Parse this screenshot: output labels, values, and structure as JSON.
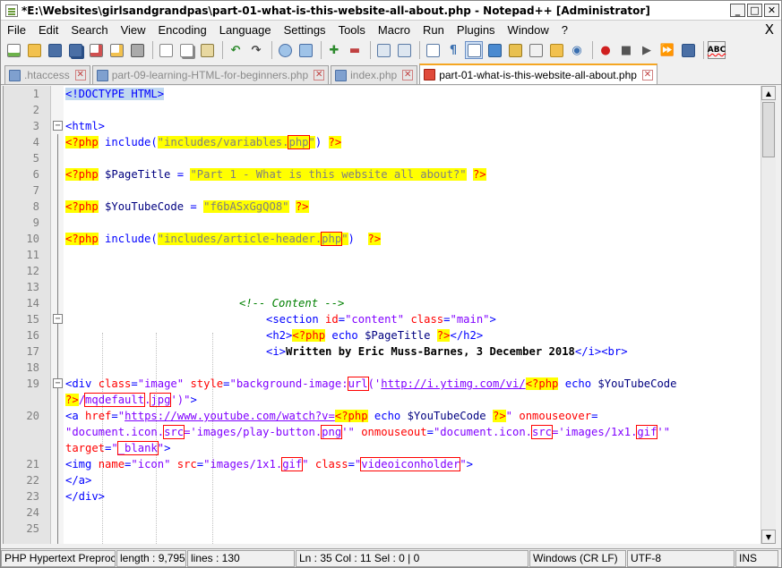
{
  "window": {
    "title": "*E:\\Websites\\girlsandgrandpas\\part-01-what-is-this-website-all-about.php - Notepad++ [Administrator]",
    "min": "_",
    "max": "□",
    "close": "✕"
  },
  "menu": [
    "File",
    "Edit",
    "Search",
    "View",
    "Encoding",
    "Language",
    "Settings",
    "Tools",
    "Macro",
    "Run",
    "Plugins",
    "Window",
    "?"
  ],
  "menu_close": "X",
  "tabs": [
    {
      "label": ".htaccess",
      "active": false
    },
    {
      "label": "part-09-learning-HTML-for-beginners.php",
      "active": false
    },
    {
      "label": "index.php",
      "active": false
    },
    {
      "label": "part-01-what-is-this-website-all-about.php",
      "active": true
    }
  ],
  "tab_close": "✕",
  "lines": [
    {
      "n": "1"
    },
    {
      "n": "2"
    },
    {
      "n": "3"
    },
    {
      "n": "4"
    },
    {
      "n": "5"
    },
    {
      "n": "6"
    },
    {
      "n": "7"
    },
    {
      "n": "8"
    },
    {
      "n": "9"
    },
    {
      "n": "10"
    },
    {
      "n": "11"
    },
    {
      "n": "12"
    },
    {
      "n": "13"
    },
    {
      "n": "14"
    },
    {
      "n": "15"
    },
    {
      "n": "16"
    },
    {
      "n": "17"
    },
    {
      "n": "18"
    },
    {
      "n": "19"
    },
    {
      "n": "20"
    },
    {
      "n": "21"
    },
    {
      "n": "22"
    },
    {
      "n": "23"
    },
    {
      "n": "24"
    },
    {
      "n": "25"
    }
  ],
  "code": {
    "l1": "<!DOCTYPE HTML>",
    "l3": "<html>",
    "l4_a": "<?php",
    "l4_b": " include(",
    "l4_c": "\"includes/variables.",
    "l4_d": "php",
    "l4_e": "\"",
    "l4_f": ") ",
    "l4_g": "?>",
    "l6_a": "<?php",
    "l6_b": " $PageTitle ",
    "l6_c": "= ",
    "l6_d": "\"Part 1 - What is this website all about?\"",
    "l6_e": " ",
    "l6_f": "?>",
    "l8_a": "<?php",
    "l8_b": " $YouTubeCode ",
    "l8_c": "= ",
    "l8_d": "\"f6bASxGgQO8\"",
    "l8_e": " ",
    "l8_f": "?>",
    "l10_a": "<?php",
    "l10_b": " include(",
    "l10_c": "\"includes/article-header.",
    "l10_d": "php",
    "l10_e": "\"",
    "l10_f": ")  ",
    "l10_g": "?>",
    "l14": "<!-- Content -->",
    "l15_a": "<section",
    "l15_b": " id",
    "l15_c": "=",
    "l15_d": "\"content\"",
    "l15_e": " class",
    "l15_f": "=",
    "l15_g": "\"main\"",
    "l15_h": ">",
    "l16_a": "<h2>",
    "l16_b": "<?php",
    "l16_c": " echo ",
    "l16_d": "$PageTitle ",
    "l16_e": "?>",
    "l16_f": "</h2>",
    "l17_a": "<i>",
    "l17_b": "Written by Eric Muss-Barnes, 3 December 2018",
    "l17_c": "</i><br>",
    "l19_a": "<div",
    "l19_b": " class",
    "l19_c": "=",
    "l19_d": "\"image\"",
    "l19_e": " style",
    "l19_f": "=",
    "l19_g": "\"background-image:",
    "l19_h": "url",
    "l19_i": "('",
    "l19_j": "http://i.ytimg.com/vi/",
    "l19_k": "<?php",
    "l19_l": " echo ",
    "l19_m": "$YouTubeCode",
    "l19b_a": "?>",
    "l19b_b": "/",
    "l19b_c": "mqdefault",
    "l19b_d": ".",
    "l19b_e": "jpg",
    "l19b_f": "')\"",
    "l19b_g": ">",
    "l20_a": "<a",
    "l20_b": " href",
    "l20_c": "=",
    "l20_d": "\"",
    "l20_e": "https://www.youtube.com/watch?v=",
    "l20_f": "<?php",
    "l20_g": " echo ",
    "l20_h": "$YouTubeCode ",
    "l20_i": "?>",
    "l20_j": "\"",
    "l20_k": " onmouseover",
    "l20_l": "=",
    "l20b_a": "\"document.icon.",
    "l20b_b": "src",
    "l20b_c": "='images/play-button.",
    "l20b_d": "png",
    "l20b_e": "'\"",
    "l20b_f": " onmouseout",
    "l20b_g": "=",
    "l20b_h": "\"document.icon.",
    "l20b_i": "src",
    "l20b_j": "='images/1x1.",
    "l20b_k": "gif",
    "l20b_l": "'\"",
    "l20c_a": "target",
    "l20c_b": "=",
    "l20c_c": "\"",
    "l20c_d": "_blank",
    "l20c_e": "\"",
    "l20c_f": ">",
    "l21_a": "<img",
    "l21_b": " name",
    "l21_c": "=",
    "l21_d": "\"icon\"",
    "l21_e": " src",
    "l21_f": "=",
    "l21_g": "\"images/1x1.",
    "l21_h": "gif",
    "l21_i": "\"",
    "l21_j": " class",
    "l21_k": "=",
    "l21_l": "\"",
    "l21_m": "videoiconholder",
    "l21_n": "\"",
    "l21_o": ">",
    "l22": "</a>",
    "l23": "</div>"
  },
  "status": {
    "lang": "PHP Hypertext Preproces",
    "length": "length : 9,795",
    "lines": "lines : 130",
    "pos": "Ln : 35    Col : 11    Sel : 0 | 0",
    "eol": "Windows (CR LF)",
    "enc": "UTF-8",
    "mode": "INS"
  }
}
